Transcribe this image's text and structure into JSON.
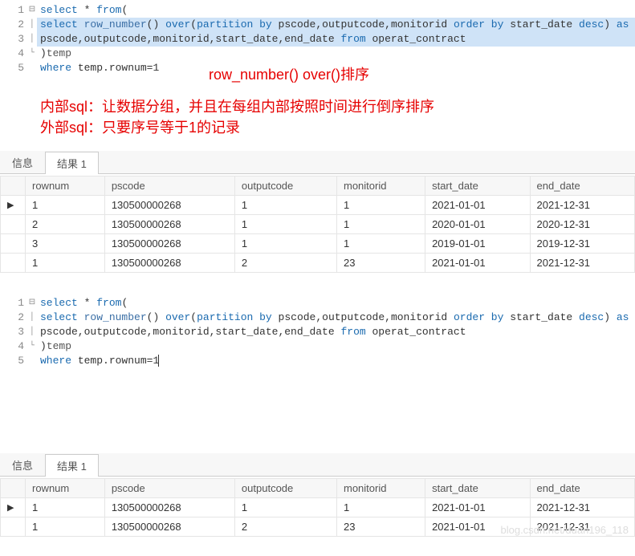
{
  "sql": {
    "l1": "select * from(",
    "l2_a": "select row_number() over(partition by pscode,outputcode,monitorid order by start_date desc) as rownum,",
    "l3_a": "pscode,outputcode,monitorid,start_date,end_date from operat_contract",
    "l4": ")temp",
    "l5": "where temp.rownum=1",
    "kw_select": "select",
    "kw_from": "from",
    "kw_over": "over",
    "kw_partition_by": "partition by",
    "kw_order_by": "order by",
    "kw_desc": "desc",
    "kw_as": "as",
    "kw_where": "where",
    "fn_rownum": "row_number",
    "sym_star": " * ",
    "sym_open": "(",
    "sym_close": ")",
    "txt_partition_cols": " pscode,outputcode,monitorid ",
    "txt_orderby_col": " start_date ",
    "txt_alias": " rownum,",
    "txt_l3_cols": "pscode,outputcode,monitorid,start_date,end_date ",
    "txt_l3_tbl": " operat_contract",
    "txt_temp": "temp",
    "txt_where_cond": " temp.rownum=",
    "txt_one": "1"
  },
  "anno": {
    "row_over": "row_number()   over()排序",
    "inner": "内部sql：让数据分组，并且在每组内部按照时间进行倒序排序",
    "outer": "外部sql：只要序号等于1的记录"
  },
  "tabs": {
    "info": "信息",
    "result": "结果 1"
  },
  "cols": {
    "rownum": "rownum",
    "pscode": "pscode",
    "outputcode": "outputcode",
    "monitorid": "monitorid",
    "start": "start_date",
    "end": "end_date"
  },
  "rows_top": [
    {
      "rownum": "1",
      "pscode": "130500000268",
      "outputcode": "1",
      "monitorid": "1",
      "start": "2021-01-01",
      "end": "2021-12-31"
    },
    {
      "rownum": "2",
      "pscode": "130500000268",
      "outputcode": "1",
      "monitorid": "1",
      "start": "2020-01-01",
      "end": "2020-12-31"
    },
    {
      "rownum": "3",
      "pscode": "130500000268",
      "outputcode": "1",
      "monitorid": "1",
      "start": "2019-01-01",
      "end": "2019-12-31"
    },
    {
      "rownum": "1",
      "pscode": "130500000268",
      "outputcode": "2",
      "monitorid": "23",
      "start": "2021-01-01",
      "end": "2021-12-31"
    }
  ],
  "rows_bottom": [
    {
      "rownum": "1",
      "pscode": "130500000268",
      "outputcode": "1",
      "monitorid": "1",
      "start": "2021-01-01",
      "end": "2021-12-31"
    },
    {
      "rownum": "1",
      "pscode": "130500000268",
      "outputcode": "2",
      "monitorid": "23",
      "start": "2021-01-01",
      "end": "2021-12-31"
    }
  ],
  "gutter": {
    "l1": "1",
    "l2": "2",
    "l3": "3",
    "l4": "4",
    "l5": "5"
  },
  "fold": {
    "open": "⊟",
    "mid": "│",
    "close": "└"
  },
  "marker": "▶",
  "watermark": "blog.csdn.net/duan196_118"
}
